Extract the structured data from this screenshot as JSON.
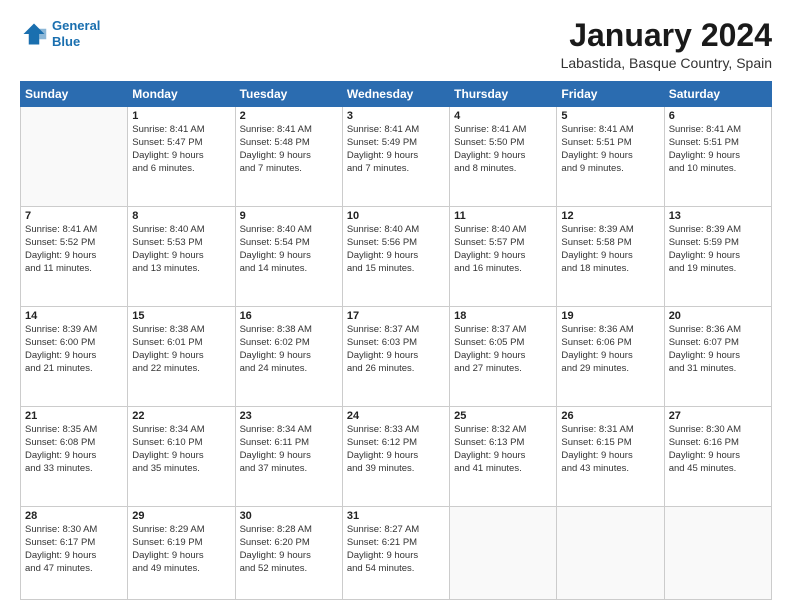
{
  "logo": {
    "line1": "General",
    "line2": "Blue"
  },
  "title": "January 2024",
  "subtitle": "Labastida, Basque Country, Spain",
  "days_of_week": [
    "Sunday",
    "Monday",
    "Tuesday",
    "Wednesday",
    "Thursday",
    "Friday",
    "Saturday"
  ],
  "weeks": [
    [
      {
        "day": "",
        "info": ""
      },
      {
        "day": "1",
        "info": "Sunrise: 8:41 AM\nSunset: 5:47 PM\nDaylight: 9 hours\nand 6 minutes."
      },
      {
        "day": "2",
        "info": "Sunrise: 8:41 AM\nSunset: 5:48 PM\nDaylight: 9 hours\nand 7 minutes."
      },
      {
        "day": "3",
        "info": "Sunrise: 8:41 AM\nSunset: 5:49 PM\nDaylight: 9 hours\nand 7 minutes."
      },
      {
        "day": "4",
        "info": "Sunrise: 8:41 AM\nSunset: 5:50 PM\nDaylight: 9 hours\nand 8 minutes."
      },
      {
        "day": "5",
        "info": "Sunrise: 8:41 AM\nSunset: 5:51 PM\nDaylight: 9 hours\nand 9 minutes."
      },
      {
        "day": "6",
        "info": "Sunrise: 8:41 AM\nSunset: 5:51 PM\nDaylight: 9 hours\nand 10 minutes."
      }
    ],
    [
      {
        "day": "7",
        "info": "Sunrise: 8:41 AM\nSunset: 5:52 PM\nDaylight: 9 hours\nand 11 minutes."
      },
      {
        "day": "8",
        "info": "Sunrise: 8:40 AM\nSunset: 5:53 PM\nDaylight: 9 hours\nand 13 minutes."
      },
      {
        "day": "9",
        "info": "Sunrise: 8:40 AM\nSunset: 5:54 PM\nDaylight: 9 hours\nand 14 minutes."
      },
      {
        "day": "10",
        "info": "Sunrise: 8:40 AM\nSunset: 5:56 PM\nDaylight: 9 hours\nand 15 minutes."
      },
      {
        "day": "11",
        "info": "Sunrise: 8:40 AM\nSunset: 5:57 PM\nDaylight: 9 hours\nand 16 minutes."
      },
      {
        "day": "12",
        "info": "Sunrise: 8:39 AM\nSunset: 5:58 PM\nDaylight: 9 hours\nand 18 minutes."
      },
      {
        "day": "13",
        "info": "Sunrise: 8:39 AM\nSunset: 5:59 PM\nDaylight: 9 hours\nand 19 minutes."
      }
    ],
    [
      {
        "day": "14",
        "info": "Sunrise: 8:39 AM\nSunset: 6:00 PM\nDaylight: 9 hours\nand 21 minutes."
      },
      {
        "day": "15",
        "info": "Sunrise: 8:38 AM\nSunset: 6:01 PM\nDaylight: 9 hours\nand 22 minutes."
      },
      {
        "day": "16",
        "info": "Sunrise: 8:38 AM\nSunset: 6:02 PM\nDaylight: 9 hours\nand 24 minutes."
      },
      {
        "day": "17",
        "info": "Sunrise: 8:37 AM\nSunset: 6:03 PM\nDaylight: 9 hours\nand 26 minutes."
      },
      {
        "day": "18",
        "info": "Sunrise: 8:37 AM\nSunset: 6:05 PM\nDaylight: 9 hours\nand 27 minutes."
      },
      {
        "day": "19",
        "info": "Sunrise: 8:36 AM\nSunset: 6:06 PM\nDaylight: 9 hours\nand 29 minutes."
      },
      {
        "day": "20",
        "info": "Sunrise: 8:36 AM\nSunset: 6:07 PM\nDaylight: 9 hours\nand 31 minutes."
      }
    ],
    [
      {
        "day": "21",
        "info": "Sunrise: 8:35 AM\nSunset: 6:08 PM\nDaylight: 9 hours\nand 33 minutes."
      },
      {
        "day": "22",
        "info": "Sunrise: 8:34 AM\nSunset: 6:10 PM\nDaylight: 9 hours\nand 35 minutes."
      },
      {
        "day": "23",
        "info": "Sunrise: 8:34 AM\nSunset: 6:11 PM\nDaylight: 9 hours\nand 37 minutes."
      },
      {
        "day": "24",
        "info": "Sunrise: 8:33 AM\nSunset: 6:12 PM\nDaylight: 9 hours\nand 39 minutes."
      },
      {
        "day": "25",
        "info": "Sunrise: 8:32 AM\nSunset: 6:13 PM\nDaylight: 9 hours\nand 41 minutes."
      },
      {
        "day": "26",
        "info": "Sunrise: 8:31 AM\nSunset: 6:15 PM\nDaylight: 9 hours\nand 43 minutes."
      },
      {
        "day": "27",
        "info": "Sunrise: 8:30 AM\nSunset: 6:16 PM\nDaylight: 9 hours\nand 45 minutes."
      }
    ],
    [
      {
        "day": "28",
        "info": "Sunrise: 8:30 AM\nSunset: 6:17 PM\nDaylight: 9 hours\nand 47 minutes."
      },
      {
        "day": "29",
        "info": "Sunrise: 8:29 AM\nSunset: 6:19 PM\nDaylight: 9 hours\nand 49 minutes."
      },
      {
        "day": "30",
        "info": "Sunrise: 8:28 AM\nSunset: 6:20 PM\nDaylight: 9 hours\nand 52 minutes."
      },
      {
        "day": "31",
        "info": "Sunrise: 8:27 AM\nSunset: 6:21 PM\nDaylight: 9 hours\nand 54 minutes."
      },
      {
        "day": "",
        "info": ""
      },
      {
        "day": "",
        "info": ""
      },
      {
        "day": "",
        "info": ""
      }
    ]
  ]
}
